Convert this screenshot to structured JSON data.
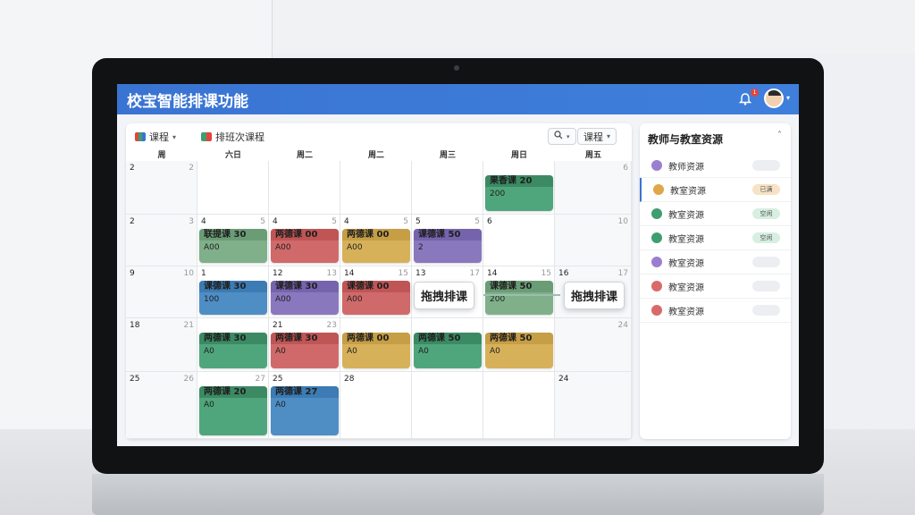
{
  "app": {
    "title": "校宝智能排课功能"
  },
  "header": {
    "notification_count": "1"
  },
  "toolbar": {
    "course_label": "课程",
    "schedule_label": "排班次课程",
    "search_label": "Q",
    "view_label": "课程"
  },
  "calendar": {
    "weekdays": [
      "周",
      "六日",
      "周二",
      "周二",
      "周三",
      "周日",
      "周五"
    ],
    "rows": [
      {
        "cells": [
          {
            "l": "2",
            "r": "2"
          },
          {
            "l": "",
            "r": ""
          },
          {
            "l": "",
            "r": ""
          },
          {
            "l": "",
            "r": ""
          },
          {
            "l": "",
            "r": ""
          },
          {
            "l": "",
            "r": ""
          },
          {
            "l": "",
            "r": "6"
          }
        ]
      },
      {
        "cells": [
          {
            "l": "2",
            "r": "3"
          },
          {
            "l": "4",
            "r": "5"
          },
          {
            "l": "4",
            "r": "5"
          },
          {
            "l": "4",
            "r": "5"
          },
          {
            "l": "5",
            "r": "5"
          },
          {
            "l": "6",
            "r": ""
          },
          {
            "l": "",
            "r": "10"
          }
        ]
      },
      {
        "cells": [
          {
            "l": "9",
            "r": "10"
          },
          {
            "l": "1",
            "r": ""
          },
          {
            "l": "12",
            "r": "13"
          },
          {
            "l": "14",
            "r": "15"
          },
          {
            "l": "13",
            "r": "17"
          },
          {
            "l": "14",
            "r": "15"
          },
          {
            "l": "16",
            "r": "17"
          }
        ]
      },
      {
        "cells": [
          {
            "l": "18",
            "r": "21"
          },
          {
            "l": "",
            "r": ""
          },
          {
            "l": "21",
            "r": "23"
          },
          {
            "l": "",
            "r": ""
          },
          {
            "l": "",
            "r": ""
          },
          {
            "l": "",
            "r": ""
          },
          {
            "l": "",
            "r": "24"
          }
        ]
      },
      {
        "cells": [
          {
            "l": "25",
            "r": "26"
          },
          {
            "l": "",
            "r": "27"
          },
          {
            "l": "25",
            "r": ""
          },
          {
            "l": "28",
            "r": ""
          },
          {
            "l": "",
            "r": ""
          },
          {
            "l": "",
            "r": ""
          },
          {
            "l": "24",
            "r": ""
          }
        ]
      }
    ],
    "events": [
      {
        "title": "果香课 20",
        "sub": "200",
        "col": 5,
        "row": 0,
        "color": "#4fa67c",
        "head": "#3c8a63"
      },
      {
        "title": "联提课 30",
        "sub": "A00",
        "col": 1,
        "row": 1,
        "color": "#7fb08a",
        "head": "#6a9d76"
      },
      {
        "title": "两德课 00",
        "sub": "A00",
        "col": 2,
        "row": 1,
        "color": "#d06a6a",
        "head": "#c05555"
      },
      {
        "title": "两德课 00",
        "sub": "A00",
        "col": 3,
        "row": 1,
        "color": "#d7b15a",
        "head": "#c69e45"
      },
      {
        "title": "课德课 50",
        "sub": "2",
        "col": 4,
        "row": 1,
        "color": "#8a78bf",
        "head": "#7663ad"
      },
      {
        "title": "课德课 30",
        "sub": "100",
        "col": 1,
        "row": 2,
        "color": "#4e8ec5",
        "head": "#3c7bb3"
      },
      {
        "title": "课德课 30",
        "sub": "A00",
        "col": 2,
        "row": 2,
        "color": "#8a78bf",
        "head": "#7663ad"
      },
      {
        "title": "课德课 00",
        "sub": "A00",
        "col": 3,
        "row": 2,
        "color": "#d06a6a",
        "head": "#c05555"
      },
      {
        "title": "课德课 50",
        "sub": "200",
        "col": 5,
        "row": 2,
        "color": "#7fb08a",
        "head": "#6a9d76"
      },
      {
        "title": "两德课 30",
        "sub": "A0",
        "col": 1,
        "row": 3,
        "color": "#4fa67c",
        "head": "#3c8a63"
      },
      {
        "title": "两德课 30",
        "sub": "A0",
        "col": 2,
        "row": 3,
        "color": "#d06a6a",
        "head": "#c05555"
      },
      {
        "title": "两德课 00",
        "sub": "A0",
        "col": 3,
        "row": 3,
        "color": "#d7b15a",
        "head": "#c69e45"
      },
      {
        "title": "两德课 50",
        "sub": "A0",
        "col": 4,
        "row": 3,
        "color": "#4fa67c",
        "head": "#3c8a63"
      },
      {
        "title": "两德课 50",
        "sub": "A0",
        "col": 5,
        "row": 3,
        "color": "#d7b15a",
        "head": "#c69e45"
      },
      {
        "title": "两德课 20",
        "sub": "A0",
        "col": 1,
        "row": 4,
        "color": "#4fa67c",
        "head": "#3c8a63"
      },
      {
        "title": "两德课 27",
        "sub": "A0",
        "col": 2,
        "row": 4,
        "color": "#4e8ec5",
        "head": "#3c7bb3"
      }
    ],
    "drag_label_left": "拖拽排课",
    "drag_label_right": "拖拽排课"
  },
  "resources": {
    "title": "教师与教室资源",
    "items": [
      {
        "label": "教师资源",
        "color": "#9b7fcf",
        "tag": "",
        "tag_color": "#eceef1"
      },
      {
        "label": "教室资源",
        "color": "#e0a64a",
        "tag": "已满",
        "tag_color": "#f6e2c5"
      },
      {
        "label": "教室资源",
        "color": "#3f9d6f",
        "tag": "空闲",
        "tag_color": "#d6efe1"
      },
      {
        "label": "教室资源",
        "color": "#3f9d6f",
        "tag": "空闲",
        "tag_color": "#d6efe1"
      },
      {
        "label": "教室资源",
        "color": "#9b7fcf",
        "tag": "",
        "tag_color": "#eceef1"
      },
      {
        "label": "教室资源",
        "color": "#d86a6a",
        "tag": "",
        "tag_color": "#eceef1"
      },
      {
        "label": "教室资源",
        "color": "#d86a6a",
        "tag": "",
        "tag_color": "#eceef1"
      }
    ]
  },
  "icons": {
    "bell": "bell-icon",
    "avatar": "avatar-icon",
    "search": "search-icon",
    "chevron": "chevron-down-icon"
  }
}
